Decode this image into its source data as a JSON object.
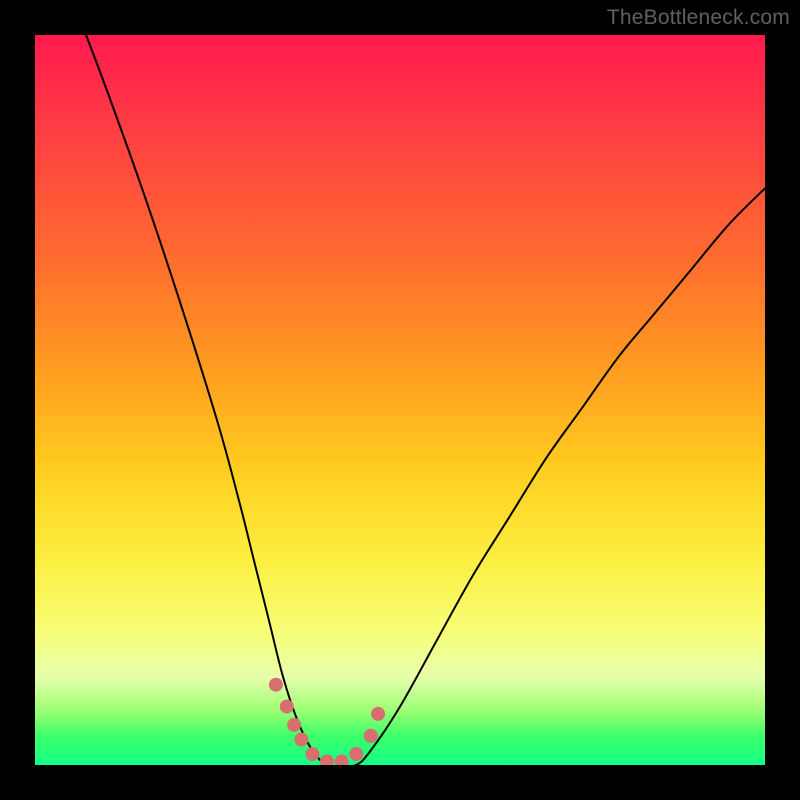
{
  "attribution": "TheBottleneck.com",
  "chart_data": {
    "type": "line",
    "title": "",
    "xlabel": "",
    "ylabel": "",
    "xlim": [
      0,
      100
    ],
    "ylim": [
      0,
      100
    ],
    "series": [
      {
        "name": "bottleneck-curve",
        "x": [
          7,
          10,
          15,
          20,
          25,
          28,
          30,
          32,
          34,
          36,
          38,
          40,
          42,
          44,
          46,
          50,
          55,
          60,
          65,
          70,
          75,
          80,
          85,
          90,
          95,
          100
        ],
        "values": [
          100,
          92,
          78,
          63,
          47,
          36,
          28,
          20,
          12,
          6,
          2,
          0,
          0,
          0,
          2,
          8,
          17,
          26,
          34,
          42,
          49,
          56,
          62,
          68,
          74,
          79
        ]
      }
    ],
    "markers": {
      "name": "bottom-dots",
      "x": [
        33,
        34.5,
        35.5,
        36.5,
        38,
        40,
        42,
        44,
        46,
        47
      ],
      "y": [
        11,
        8,
        5.5,
        3.5,
        1.5,
        0.5,
        0.5,
        1.5,
        4,
        7
      ],
      "color": "#d86f6f",
      "radius_px": 7
    },
    "annotations": []
  }
}
